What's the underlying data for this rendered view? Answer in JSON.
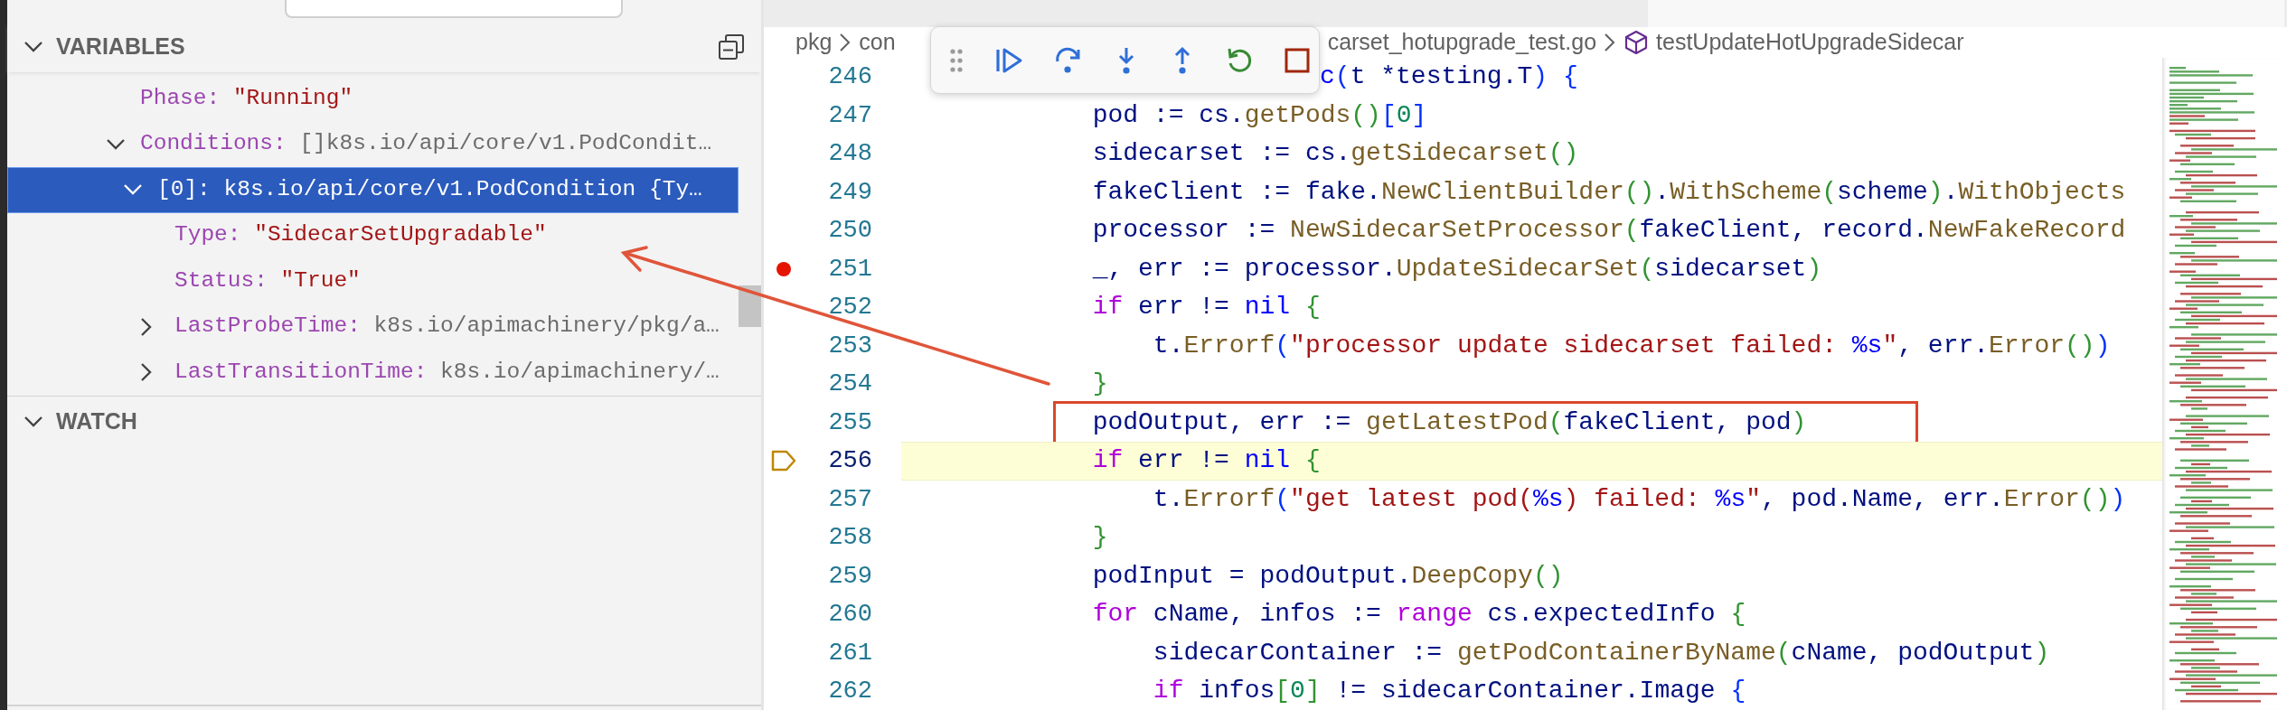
{
  "variables": {
    "title": "VARIABLES",
    "expanded": true,
    "items": [
      {
        "name": "Phase:",
        "value": "\"Running\"",
        "kind": "string",
        "selected": false
      },
      {
        "name": "Conditions:",
        "value": "[]k8s.io/api/core/v1.PodCondit…",
        "kind": "type",
        "expanded": true,
        "selected": false,
        "children": [
          {
            "name": "[0]:",
            "value": "k8s.io/api/core/v1.PodCondition {Ty…",
            "kind": "type",
            "expanded": true,
            "selected": true,
            "children": [
              {
                "name": "Type:",
                "value": "\"SidecarSetUpgradable\"",
                "kind": "string",
                "selected": false
              },
              {
                "name": "Status:",
                "value": "\"True\"",
                "kind": "string",
                "selected": false
              },
              {
                "name": "LastProbeTime:",
                "value": "k8s.io/apimachinery/pkg/a…",
                "kind": "type",
                "expanded": false,
                "selected": false
              },
              {
                "name": "LastTransitionTime:",
                "value": "k8s.io/apimachinery/…",
                "kind": "type",
                "expanded": false,
                "selected": false
              }
            ]
          }
        ]
      }
    ]
  },
  "watch": {
    "title": "WATCH",
    "expanded": true
  },
  "editor": {
    "breadcrumb": [
      {
        "label": "pkg",
        "kind": "folder"
      },
      {
        "label": "con",
        "kind": "folder",
        "covered": true
      },
      {
        "label": "carset_hotupgrade_test.go",
        "kind": "file"
      },
      {
        "label": "testUpdateHotUpgradeSidecar",
        "kind": "symbol"
      }
    ],
    "lines": [
      {
        "number": "246",
        "covered": true,
        "tokens": [
          {
            "text": "c",
            "kind": "const"
          },
          {
            "text": "(",
            "kind": "b2"
          },
          {
            "text": "t *testing.T",
            "kind": "plain"
          },
          {
            "text": ")",
            "kind": "b2"
          },
          {
            "text": " {",
            "kind": "b2"
          }
        ]
      },
      {
        "number": "247",
        "tokens": [
          {
            "text": "\t\t\tpod := cs.",
            "kind": "plain"
          },
          {
            "text": "getPods",
            "kind": "fn"
          },
          {
            "text": "()",
            "kind": "b1"
          },
          {
            "text": "[",
            "kind": "b2"
          },
          {
            "text": "0",
            "kind": "num"
          },
          {
            "text": "]",
            "kind": "b2"
          }
        ]
      },
      {
        "number": "248",
        "tokens": [
          {
            "text": "\t\t\tsidecarset := cs.",
            "kind": "plain"
          },
          {
            "text": "getSidecarset",
            "kind": "fn"
          },
          {
            "text": "()",
            "kind": "b1"
          }
        ]
      },
      {
        "number": "249",
        "tokens": [
          {
            "text": "\t\t\tfakeClient := fake.",
            "kind": "plain"
          },
          {
            "text": "NewClientBuilder",
            "kind": "fn"
          },
          {
            "text": "()",
            "kind": "b1"
          },
          {
            "text": ".",
            "kind": "plain"
          },
          {
            "text": "WithScheme",
            "kind": "fn"
          },
          {
            "text": "(",
            "kind": "b1"
          },
          {
            "text": "scheme",
            "kind": "plain"
          },
          {
            "text": ")",
            "kind": "b1"
          },
          {
            "text": ".",
            "kind": "plain"
          },
          {
            "text": "WithObjects",
            "kind": "fn"
          }
        ]
      },
      {
        "number": "250",
        "tokens": [
          {
            "text": "\t\t\tprocessor := ",
            "kind": "plain"
          },
          {
            "text": "NewSidecarSetProcessor",
            "kind": "fn"
          },
          {
            "text": "(",
            "kind": "b1"
          },
          {
            "text": "fakeClient, record.",
            "kind": "plain"
          },
          {
            "text": "NewFakeRecord",
            "kind": "fn"
          }
        ]
      },
      {
        "number": "251",
        "breakpoint": true,
        "tokens": [
          {
            "text": "\t\t\t_, err := processor.",
            "kind": "plain"
          },
          {
            "text": "UpdateSidecarSet",
            "kind": "fn"
          },
          {
            "text": "(",
            "kind": "b1"
          },
          {
            "text": "sidecarset",
            "kind": "plain"
          },
          {
            "text": ")",
            "kind": "b1"
          }
        ]
      },
      {
        "number": "252",
        "tokens": [
          {
            "text": "\t\t\tif",
            "kind": "kw"
          },
          {
            "text": " err != ",
            "kind": "plain"
          },
          {
            "text": "nil",
            "kind": "const"
          },
          {
            "text": " {",
            "kind": "b1"
          }
        ]
      },
      {
        "number": "253",
        "tokens": [
          {
            "text": "\t\t\t\tt.",
            "kind": "plain"
          },
          {
            "text": "Errorf",
            "kind": "fn"
          },
          {
            "text": "(",
            "kind": "b2"
          },
          {
            "text": "\"processor update sidecarset failed: ",
            "kind": "str"
          },
          {
            "text": "%s",
            "kind": "fmt"
          },
          {
            "text": "\"",
            "kind": "str"
          },
          {
            "text": ", err.",
            "kind": "plain"
          },
          {
            "text": "Error",
            "kind": "fn"
          },
          {
            "text": "()",
            "kind": "b1"
          },
          {
            "text": ")",
            "kind": "b2"
          }
        ]
      },
      {
        "number": "254",
        "tokens": [
          {
            "text": "\t\t\t}",
            "kind": "b1"
          }
        ]
      },
      {
        "number": "255",
        "annotated": true,
        "tokens": [
          {
            "text": "\t\t\tpodOutput, err := ",
            "kind": "plain"
          },
          {
            "text": "getLatestPod",
            "kind": "fn"
          },
          {
            "text": "(",
            "kind": "b1"
          },
          {
            "text": "fakeClient, pod",
            "kind": "plain"
          },
          {
            "text": ")",
            "kind": "b1"
          }
        ]
      },
      {
        "number": "256",
        "current": true,
        "tokens": [
          {
            "text": "\t\t\tif",
            "kind": "kw"
          },
          {
            "text": " err != ",
            "kind": "plain"
          },
          {
            "text": "nil",
            "kind": "const"
          },
          {
            "text": " {",
            "kind": "b1"
          }
        ]
      },
      {
        "number": "257",
        "tokens": [
          {
            "text": "\t\t\t\tt.",
            "kind": "plain"
          },
          {
            "text": "Errorf",
            "kind": "fn"
          },
          {
            "text": "(",
            "kind": "b2"
          },
          {
            "text": "\"get latest pod(",
            "kind": "str"
          },
          {
            "text": "%s",
            "kind": "fmt"
          },
          {
            "text": ") failed: ",
            "kind": "str"
          },
          {
            "text": "%s",
            "kind": "fmt"
          },
          {
            "text": "\"",
            "kind": "str"
          },
          {
            "text": ", pod.Name, err.",
            "kind": "plain"
          },
          {
            "text": "Error",
            "kind": "fn"
          },
          {
            "text": "()",
            "kind": "b1"
          },
          {
            "text": ")",
            "kind": "b2"
          }
        ]
      },
      {
        "number": "258",
        "tokens": [
          {
            "text": "\t\t\t}",
            "kind": "b1"
          }
        ]
      },
      {
        "number": "259",
        "tokens": [
          {
            "text": "\t\t\tpodInput = podOutput.",
            "kind": "plain"
          },
          {
            "text": "DeepCopy",
            "kind": "fn"
          },
          {
            "text": "()",
            "kind": "b1"
          }
        ]
      },
      {
        "number": "260",
        "tokens": [
          {
            "text": "\t\t\tfor",
            "kind": "kw"
          },
          {
            "text": " cName, infos := ",
            "kind": "plain"
          },
          {
            "text": "range",
            "kind": "kw"
          },
          {
            "text": " cs.expectedInfo ",
            "kind": "plain"
          },
          {
            "text": "{",
            "kind": "b1"
          }
        ]
      },
      {
        "number": "261",
        "tokens": [
          {
            "text": "\t\t\t\tsidecarContainer := ",
            "kind": "plain"
          },
          {
            "text": "getPodContainerByName",
            "kind": "fn"
          },
          {
            "text": "(",
            "kind": "b1"
          },
          {
            "text": "cName, podOutput",
            "kind": "plain"
          },
          {
            "text": ")",
            "kind": "b1"
          }
        ]
      },
      {
        "number": "262",
        "tokens": [
          {
            "text": "\t\t\t\tif",
            "kind": "kw"
          },
          {
            "text": " infos",
            "kind": "plain"
          },
          {
            "text": "[",
            "kind": "b1"
          },
          {
            "text": "0",
            "kind": "num"
          },
          {
            "text": "]",
            "kind": "b1"
          },
          {
            "text": " != sidecarContainer.Image ",
            "kind": "plain"
          },
          {
            "text": "{",
            "kind": "b2"
          }
        ]
      }
    ]
  }
}
